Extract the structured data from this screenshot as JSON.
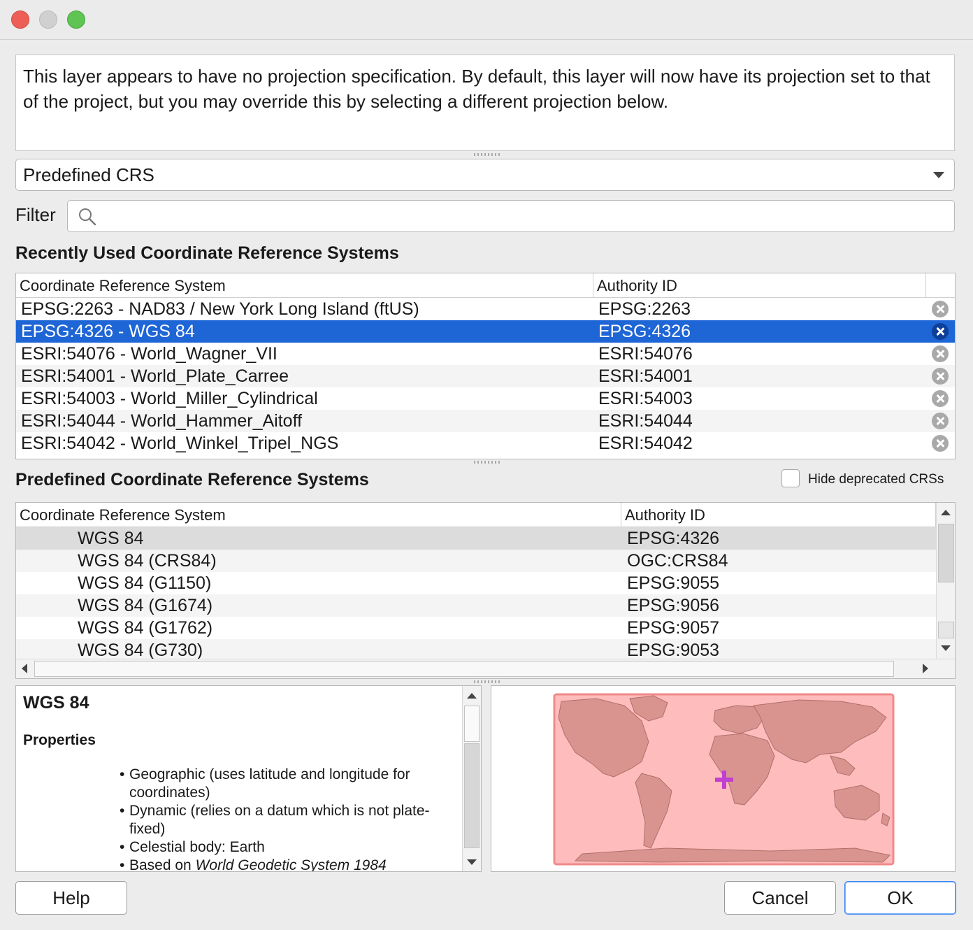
{
  "message": "This layer appears to have no projection specification. By default, this layer will now have its projection set to that of the project, but you may override this by selecting a different projection below.",
  "mode_select": {
    "value": "Predefined CRS"
  },
  "filter": {
    "label": "Filter",
    "value": ""
  },
  "recent": {
    "title": "Recently Used Coordinate Reference Systems",
    "columns": [
      "Coordinate Reference System",
      "Authority ID"
    ],
    "rows": [
      {
        "name": "EPSG:2263 - NAD83 / New York Long Island (ftUS)",
        "id": "EPSG:2263"
      },
      {
        "name": "EPSG:4326 - WGS 84",
        "id": "EPSG:4326"
      },
      {
        "name": "ESRI:54076 - World_Wagner_VII",
        "id": "ESRI:54076"
      },
      {
        "name": "ESRI:54001 - World_Plate_Carree",
        "id": "ESRI:54001"
      },
      {
        "name": "ESRI:54003 - World_Miller_Cylindrical",
        "id": "ESRI:54003"
      },
      {
        "name": "ESRI:54044 - World_Hammer_Aitoff",
        "id": "ESRI:54044"
      },
      {
        "name": "ESRI:54042 - World_Winkel_Tripel_NGS",
        "id": "ESRI:54042"
      }
    ],
    "selected_index": 1
  },
  "predefined": {
    "title": "Predefined Coordinate Reference Systems",
    "hide_deprecated_label": "Hide deprecated CRSs",
    "hide_deprecated_checked": false,
    "columns": [
      "Coordinate Reference System",
      "Authority ID"
    ],
    "rows": [
      {
        "name": "WGS 84",
        "id": "EPSG:4326"
      },
      {
        "name": "WGS 84 (CRS84)",
        "id": "OGC:CRS84"
      },
      {
        "name": "WGS 84 (G1150)",
        "id": "EPSG:9055"
      },
      {
        "name": "WGS 84 (G1674)",
        "id": "EPSG:9056"
      },
      {
        "name": "WGS 84 (G1762)",
        "id": "EPSG:9057"
      },
      {
        "name": "WGS 84 (G730)",
        "id": "EPSG:9053"
      }
    ],
    "highlighted_index": 0
  },
  "details": {
    "title": "WGS 84",
    "subtitle": "Properties",
    "items": [
      "Geographic (uses latitude and longitude for coordinates)",
      "Dynamic (relies on a datum which is not plate-fixed)",
      "Celestial body: Earth"
    ],
    "based_on_prefix": "Based on",
    "based_on_value": "World Geodetic System 1984"
  },
  "colors": {
    "selection": "#1e65d6",
    "map_extent_fill": "#ffbcbc",
    "map_extent_border": "#f08a8a",
    "land": "#d9948f",
    "crosshair": "#c040d0"
  },
  "buttons": {
    "help": "Help",
    "cancel": "Cancel",
    "ok": "OK"
  }
}
